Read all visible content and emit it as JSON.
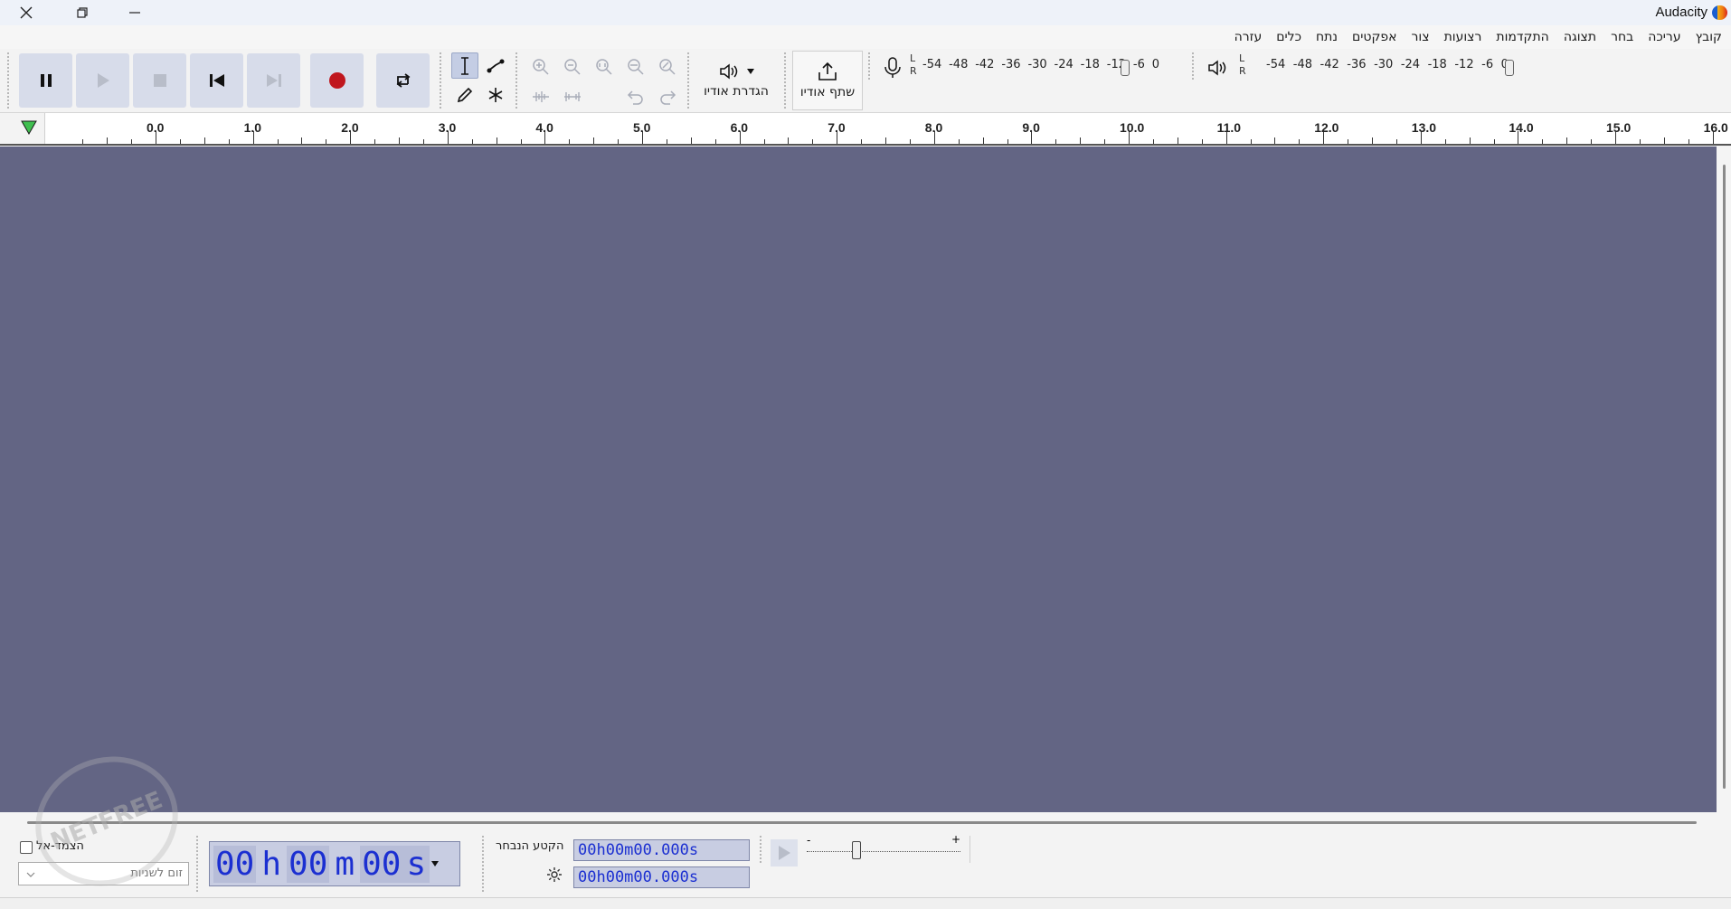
{
  "window": {
    "title": "Audacity"
  },
  "menu": {
    "items": [
      "קובץ",
      "עריכה",
      "בחר",
      "תצוגה",
      "התקדמות",
      "רצועות",
      "צור",
      "אפקטים",
      "נתח",
      "כלים",
      "עזרה"
    ]
  },
  "toolbar": {
    "audio_setup_label": "הגדרת אודיו",
    "share_audio_label": "שתף אודיו"
  },
  "meters": {
    "record": {
      "left_label": "L",
      "right_label": "R",
      "scale": [
        "-54",
        "-48",
        "-42",
        "-36",
        "-30",
        "-24",
        "-18",
        "-12",
        "-6",
        "0"
      ]
    },
    "playback": {
      "left_label": "L",
      "right_label": "R",
      "scale": [
        "-54",
        "-48",
        "-42",
        "-36",
        "-30",
        "-24",
        "-18",
        "-12",
        "-6",
        "0"
      ]
    }
  },
  "ruler": {
    "labels": [
      "0.0",
      "1.0",
      "2.0",
      "3.0",
      "4.0",
      "5.0",
      "6.0",
      "7.0",
      "8.0",
      "9.0",
      "10.0",
      "11.0",
      "12.0",
      "13.0",
      "14.0",
      "15.0",
      "16.0"
    ]
  },
  "bottom": {
    "snap_label": "הצמד-אל",
    "snap_select_value": "זום לשניות",
    "time_display": {
      "h_val": "00",
      "h_unit": "h",
      "m_val": "00",
      "m_unit": "m",
      "s_val": "00",
      "s_unit": "s"
    },
    "selection_label": "הקטע הנבחר",
    "selection_start": "00h00m00.000s",
    "selection_end": "00h00m00.000s",
    "speed_min": "-",
    "speed_max": "+"
  },
  "watermark": {
    "text": "NETFREE"
  },
  "colors": {
    "track_bg": "#636584",
    "time_digits": "#1b2fd1",
    "record_red": "#c0171e",
    "toolbar_button": "#d7dcea"
  }
}
